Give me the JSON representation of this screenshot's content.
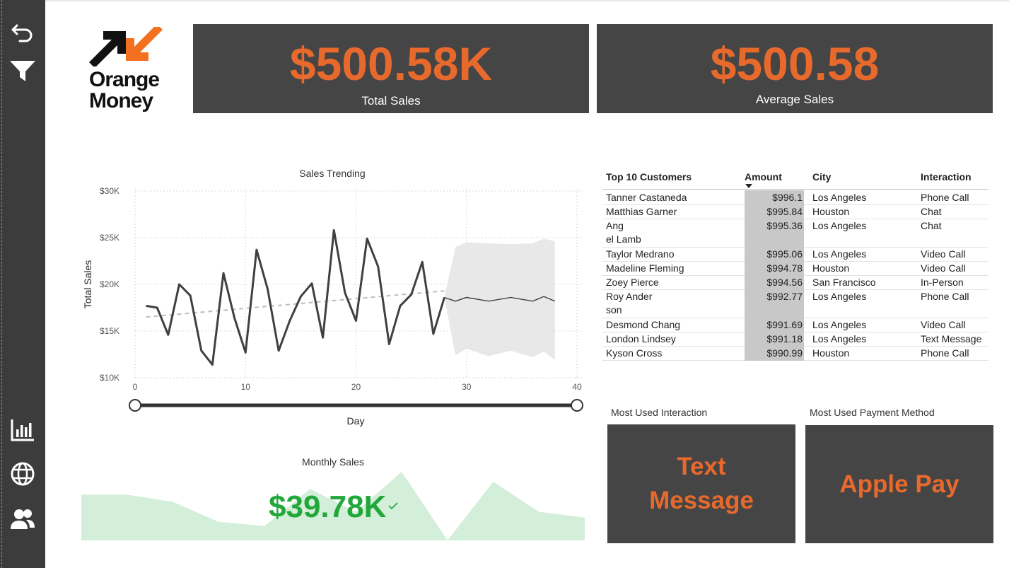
{
  "kpis": {
    "total_sales": {
      "value": "$500.58K",
      "label": "Total Sales"
    },
    "average_sales": {
      "value": "$500.58",
      "label": "Average Sales"
    }
  },
  "logo": {
    "line1": "Orange",
    "line2": "Money"
  },
  "sidebar": {
    "icons": [
      "back-icon",
      "filter-icon",
      "bar-chart-icon",
      "globe-icon",
      "users-icon"
    ]
  },
  "colors": {
    "accent": "#e8692c",
    "card_bg": "#454545",
    "sidebar_bg": "#3c3c3c",
    "monthly_value": "#22a83a",
    "monthly_area": "#d3eed9"
  },
  "sales_trending": {
    "title": "Sales Trending",
    "chart_data": {
      "type": "line",
      "title": "Sales Trending",
      "xlabel": "Day",
      "ylabel": "Total Sales",
      "xlim": [
        0,
        40
      ],
      "ylim": [
        10000,
        30000
      ],
      "x_ticks": [
        "0",
        "10",
        "20",
        "30",
        "40"
      ],
      "y_ticks": [
        "$10K",
        "$15K",
        "$20K",
        "$25K",
        "$30K"
      ],
      "series": [
        {
          "values": [
            [
              1,
              17700
            ],
            [
              2,
              17500
            ],
            [
              3,
              14600
            ],
            [
              4,
              20000
            ],
            [
              5,
              18800
            ],
            [
              6,
              12900
            ],
            [
              7,
              11400
            ],
            [
              8,
              21200
            ],
            [
              9,
              16400
            ],
            [
              10,
              12700
            ],
            [
              11,
              23700
            ],
            [
              12,
              19500
            ],
            [
              13,
              12900
            ],
            [
              14,
              16100
            ],
            [
              15,
              18700
            ],
            [
              16,
              20100
            ],
            [
              17,
              14300
            ],
            [
              18,
              25800
            ],
            [
              19,
              19100
            ],
            [
              20,
              16100
            ],
            [
              21,
              24900
            ],
            [
              22,
              21900
            ],
            [
              23,
              13600
            ],
            [
              24,
              17700
            ],
            [
              25,
              18900
            ],
            [
              26,
              22400
            ],
            [
              27,
              14700
            ],
            [
              28,
              18600
            ]
          ]
        }
      ],
      "trend": [
        [
          1,
          16500
        ],
        [
          28,
          19300
        ]
      ],
      "forecast": [
        [
          28,
          18600
        ],
        [
          29,
          18200
        ],
        [
          30,
          18600
        ],
        [
          32,
          18200
        ],
        [
          34,
          18600
        ],
        [
          36,
          18200
        ],
        [
          37,
          18700
        ],
        [
          38,
          18200
        ]
      ],
      "forecast_upper": [
        [
          28,
          18600
        ],
        [
          29,
          24000
        ],
        [
          30,
          24500
        ],
        [
          32,
          24400
        ],
        [
          34,
          24300
        ],
        [
          36,
          24400
        ],
        [
          37,
          24900
        ],
        [
          38,
          24600
        ]
      ],
      "forecast_lower": [
        [
          28,
          18600
        ],
        [
          29,
          12400
        ],
        [
          30,
          13100
        ],
        [
          32,
          12300
        ],
        [
          34,
          12900
        ],
        [
          36,
          12200
        ],
        [
          37,
          12800
        ],
        [
          38,
          11900
        ]
      ],
      "slider_range": [
        0,
        40
      ],
      "grid": true
    }
  },
  "table": {
    "headers": [
      "Top 10 Customers",
      "Amount",
      "City",
      "Interaction"
    ],
    "rows": [
      {
        "name": "Tanner Castaneda",
        "amount": "$996.1",
        "city": "Los Angeles",
        "interaction": "Phone Call"
      },
      {
        "name": "Matthias Garner",
        "amount": "$995.84",
        "city": "Houston",
        "interaction": "Chat"
      },
      {
        "name": "Ang",
        "name2": "el Lamb",
        "amount": "$995.36",
        "city": "Los Angeles",
        "interaction": "Chat"
      },
      {
        "name": "Taylor Medrano",
        "amount": "$995.06",
        "city": "Los Angeles",
        "interaction": "Video Call"
      },
      {
        "name": "Madeline Fleming",
        "amount": "$994.78",
        "city": "Houston",
        "interaction": "Video Call"
      },
      {
        "name": "Zoey Pierce",
        "amount": "$994.56",
        "city": "San Francisco",
        "interaction": "In-Person"
      },
      {
        "name": "Roy Ander",
        "name2": "son",
        "amount": "$992.77",
        "city": "Los Angeles",
        "interaction": "Phone Call"
      },
      {
        "name": "Desmond Chang",
        "amount": "$991.69",
        "city": "Los Angeles",
        "interaction": "Video Call"
      },
      {
        "name": "London Lindsey",
        "amount": "$991.18",
        "city": "Los Angeles",
        "interaction": "Text Message"
      },
      {
        "name": "Kyson Cross",
        "amount": "$990.99",
        "city": "Houston",
        "interaction": "Phone Call"
      }
    ]
  },
  "cards": {
    "interaction": {
      "title": "Most Used Interaction",
      "line1": "Text",
      "line2": "Message"
    },
    "payment": {
      "title": "Most Used Payment Method",
      "value": "Apple Pay"
    }
  },
  "monthly": {
    "title": "Monthly Sales",
    "value": "$39.78K",
    "chart_data": {
      "type": "area",
      "values": [
        32,
        32,
        27,
        13,
        10,
        36,
        20,
        48,
        0,
        41,
        20,
        16
      ]
    }
  }
}
